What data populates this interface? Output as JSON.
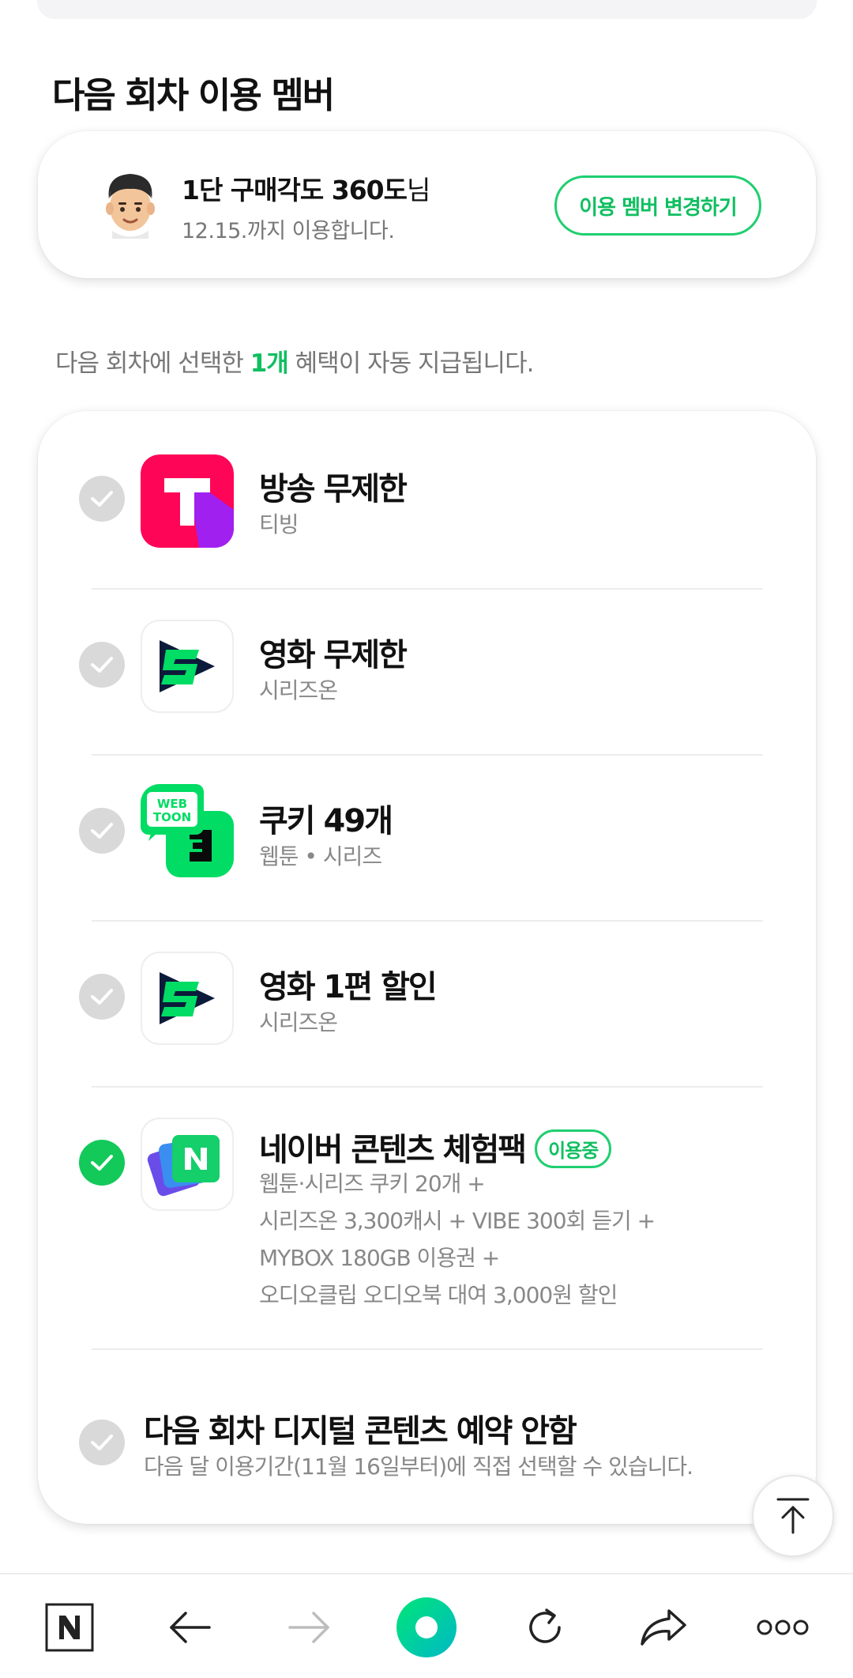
{
  "section_title": "다음 회차 이용 멤버",
  "member": {
    "name": "1단 구매각도 360도",
    "name_suffix": "님",
    "until": "12.15.까지 이용합니다.",
    "change_button": "이용 멤버 변경하기"
  },
  "notice": {
    "prefix": "다음 회차에 선택한 ",
    "count": "1개",
    "suffix": " 혜택이 자동 지급됩니다."
  },
  "benefits": [
    {
      "title": "방송 무제한",
      "subtitle": "티빙",
      "icon": "tving-icon",
      "selected": false
    },
    {
      "title": "영화 무제한",
      "subtitle": "시리즈온",
      "icon": "serieson-icon",
      "selected": false
    },
    {
      "title": "쿠키 49개",
      "subtitle": "웹툰 • 시리즈",
      "icon": "webtoon-icon",
      "selected": false
    },
    {
      "title": "영화 1편 할인",
      "subtitle": "시리즈온",
      "icon": "serieson-icon",
      "selected": false
    },
    {
      "title": "네이버 콘텐츠 체험팩",
      "badge": "이용중",
      "icon": "naver-pack-icon",
      "selected": true,
      "description": [
        "웹툰·시리즈 쿠키 20개 +",
        "시리즈온 3,300캐시 + VIBE 300회 듣기 +",
        "MYBOX 180GB 이용권 +",
        "오디오클립 오디오북 대여 3,000원 할인"
      ]
    }
  ],
  "no_reserve": {
    "title": "다음 회차 디지털 콘텐츠 예약 안함",
    "subtitle": "다음 달 이용기간(11월 16일부터)에 직접 선택할 수 있습니다."
  },
  "colors": {
    "accent_green": "#12c95a",
    "tving_red": "#ff0558",
    "tving_purple": "#a020f0",
    "webtoon_green": "#00dc64"
  },
  "bottom_nav": [
    "naver-home-icon",
    "back-arrow-icon",
    "forward-arrow-icon",
    "green-dot-icon",
    "refresh-icon",
    "share-icon",
    "more-icon"
  ]
}
